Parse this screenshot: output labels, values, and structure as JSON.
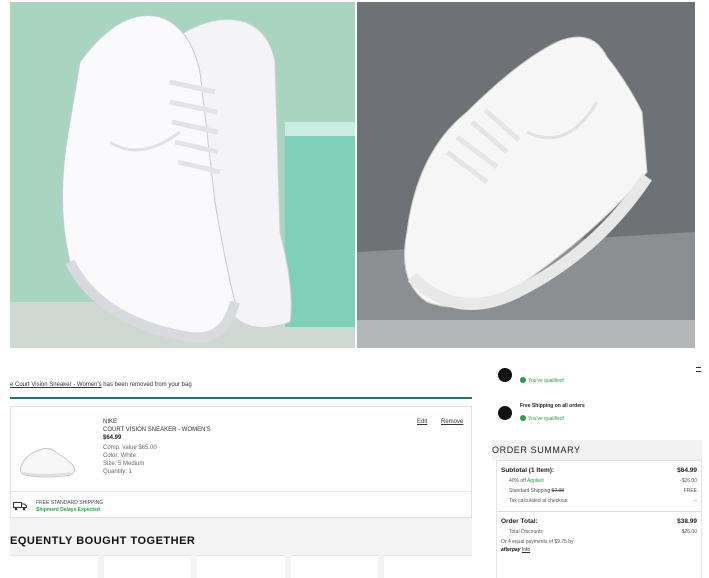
{
  "images": {
    "left_alt": "white sneakers on green background",
    "right_alt": "white sneaker on gray background"
  },
  "notice": {
    "link_text": "e Court Vision Sneaker - Women's",
    "rest_text": " has been removed from your bag"
  },
  "cart_item": {
    "brand": "NIKE",
    "name": "COURT VISION SNEAKER - WOMEN'S",
    "price": "$64.99",
    "comp_value": "Comp. value $65.00",
    "color": "Color: White",
    "size": "Size: 5 Medium",
    "quantity": "Quantity: 1",
    "edit_label": "Edit",
    "remove_label": "Remove",
    "shipping_label": "FREE STANDARD SHIPPING",
    "shipping_note": "Shipment Delays Expected"
  },
  "fbt_title": "EQUENTLY BOUGHT TOGETHER",
  "promos": [
    {
      "title": "",
      "status": "You've qualified!",
      "icon": "tag-icon"
    },
    {
      "title": "Free Shipping on all orders",
      "status": "You've qualified!",
      "icon": "truck-icon"
    }
  ],
  "summary": {
    "title": "ORDER SUMMARY",
    "subtotal_label": "Subtotal (1 Item):",
    "subtotal_value": "$64.99",
    "discount_label": "40% off",
    "discount_applied": "Applied",
    "discount_value": "-$26.00",
    "std_shipping_label": "Standard Shipping",
    "std_shipping_strike": "$7.98",
    "std_shipping_value": "FREE",
    "tax_label": "Tax calculated at checkout",
    "tax_value": "--",
    "total_label": "Order Total:",
    "total_value": "$38.99",
    "total_discounts_label": "Total Discounts",
    "total_discounts_value": "$26.00",
    "installments_text": "Or 4 equal payments of $9.75 by",
    "afterpay_label": "afterpay",
    "info_label": "Info"
  },
  "colors": {
    "accent_teal": "#2f6f73",
    "success_green": "#2e9e4a",
    "mint_bg": "#a8d4bf",
    "gray_bg": "#6f7276"
  }
}
